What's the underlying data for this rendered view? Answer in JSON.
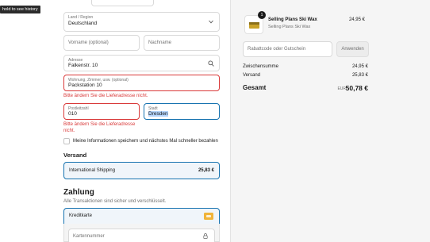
{
  "tooltip": "hold to see history",
  "address": {
    "country_label": "Land / Region",
    "country_value": "Deutschland",
    "first_name_placeholder": "Vorname (optional)",
    "last_name_placeholder": "Nachname",
    "street_label": "Adresse",
    "street_value": "Falkenstr. 10",
    "apartment_label": "Wohnung, Zimmer, usw. (optional)",
    "apartment_value": "Packstation 10",
    "apartment_error": "Bitte ändern Sie die Lieferadresse nicht.",
    "zip_label": "Postleitzahl",
    "zip_value": "010",
    "city_label": "Stadt",
    "city_value": "Dresden",
    "zip_error_line1": "Bitte ändern Sie die Lieferadresse",
    "zip_error_line2": "nicht.",
    "save_info_label": "Meine Informationen speichern und nächstes Mal schneller bezahlen"
  },
  "shipping": {
    "heading": "Versand",
    "method_name": "International Shipping",
    "method_price": "25,83 €"
  },
  "payment": {
    "heading": "Zahlung",
    "subtitle": "Alle Transaktionen sind sicher und verschlüsselt.",
    "method_label": "Kreditkarte",
    "card_number_placeholder": "Kartennummer"
  },
  "summary": {
    "quantity_badge": "1",
    "product_name": "Selling Plans Ski Wax",
    "product_variant": "Selling Plans Ski Wax",
    "product_price": "24,95 €",
    "discount_placeholder": "Rabattcode oder Gutschein",
    "apply_label": "Anwenden",
    "subtotal_label": "Zwischensumme",
    "subtotal_value": "24,95 €",
    "shipping_label": "Versand",
    "shipping_value": "25,83 €",
    "total_label": "Gesamt",
    "total_currency": "EUR",
    "total_value": "50,78 €"
  },
  "colors": {
    "accent": "#1773b0",
    "error": "#d93a3a",
    "card_badge": "#f0b43a"
  },
  "icons": [
    "chevron-down-icon",
    "search-icon",
    "lock-icon",
    "credit-card-icon"
  ]
}
